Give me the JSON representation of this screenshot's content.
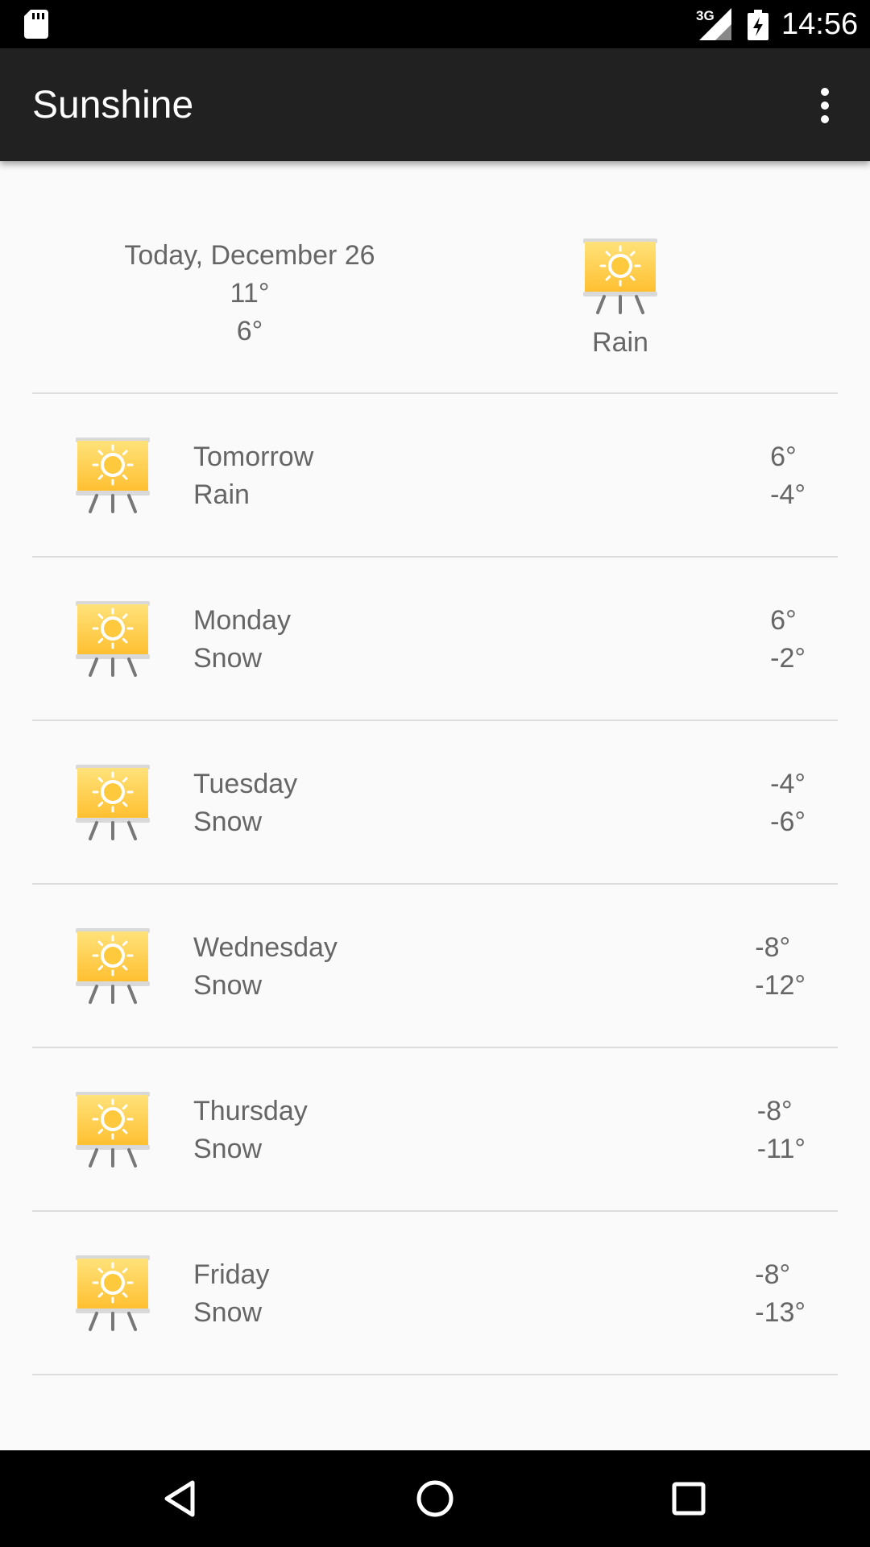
{
  "status_bar": {
    "time": "14:56",
    "network": "3G",
    "icons": [
      "sd-card-icon",
      "signal-icon",
      "battery-icon"
    ]
  },
  "app_bar": {
    "title": "Sunshine",
    "menu_icon": "overflow-menu-icon"
  },
  "today": {
    "date": "Today, December 26",
    "high": "11°",
    "low": "6°",
    "description": "Rain",
    "icon": "sun-easel-icon"
  },
  "forecast": [
    {
      "day": "Tomorrow",
      "description": "Rain",
      "high": "6°",
      "low": "-4°",
      "icon": "sun-easel-icon"
    },
    {
      "day": "Monday",
      "description": "Snow",
      "high": "6°",
      "low": "-2°",
      "icon": "sun-easel-icon"
    },
    {
      "day": "Tuesday",
      "description": "Snow",
      "high": "-4°",
      "low": "-6°",
      "icon": "sun-easel-icon"
    },
    {
      "day": "Wednesday",
      "description": "Snow",
      "high": "-8°",
      "low": "-12°",
      "icon": "sun-easel-icon"
    },
    {
      "day": "Thursday",
      "description": "Snow",
      "high": "-8°",
      "low": "-11°",
      "icon": "sun-easel-icon"
    },
    {
      "day": "Friday",
      "description": "Snow",
      "high": "-8°",
      "low": "-13°",
      "icon": "sun-easel-icon"
    }
  ],
  "nav_bar": {
    "buttons": [
      "back-icon",
      "home-icon",
      "recents-icon"
    ]
  },
  "colors": {
    "status_bar": "#000000",
    "app_bar": "#212121",
    "background": "#fafafa",
    "text_secondary": "#666666",
    "divider": "#dddddd",
    "icon_sun": "#ffc93d"
  }
}
